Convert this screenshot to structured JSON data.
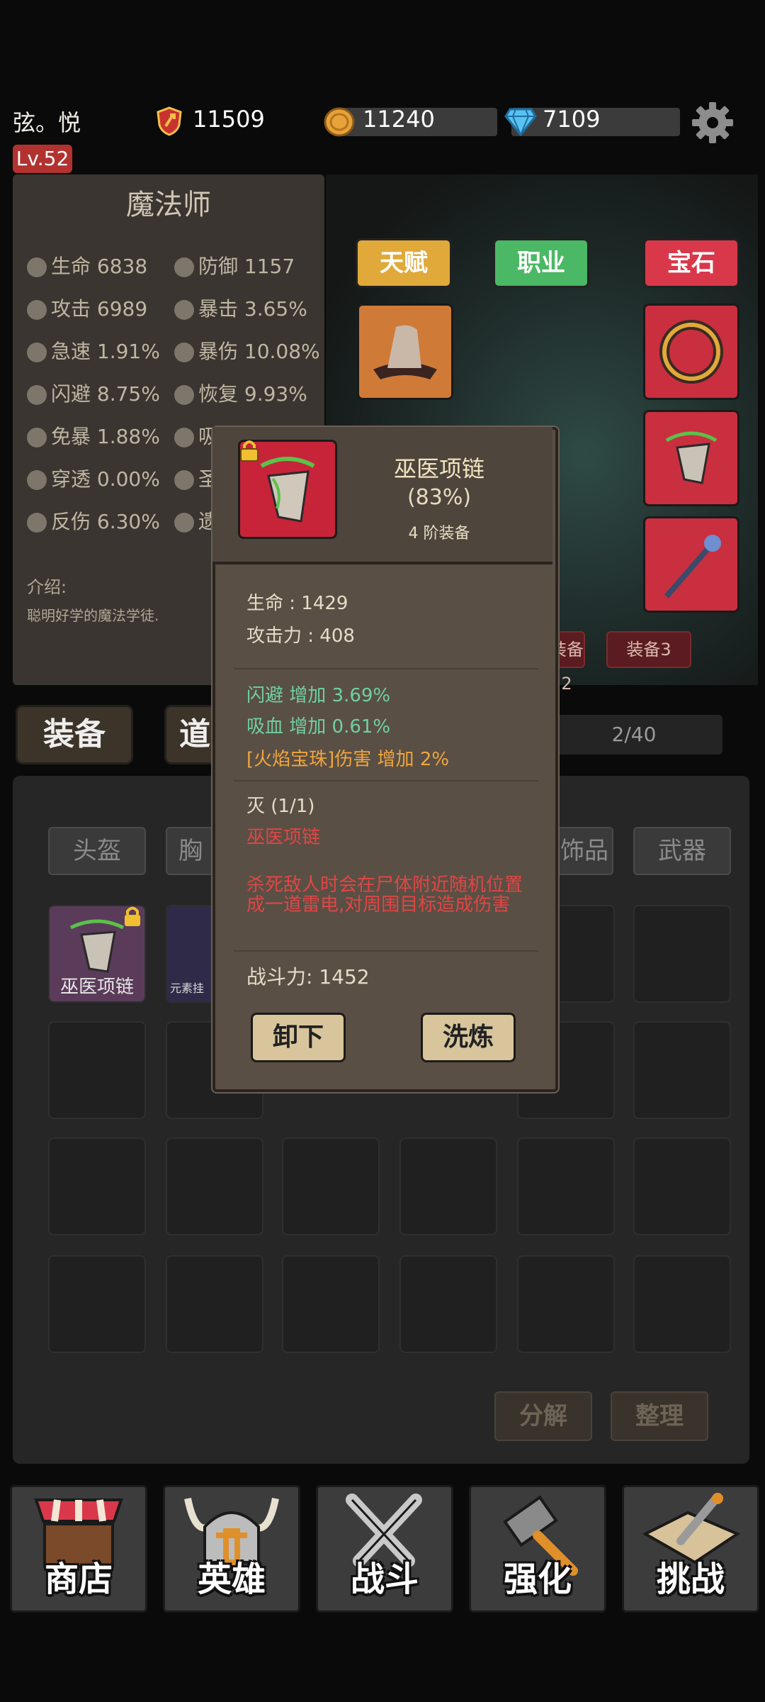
{
  "top_bar": {
    "player_name": "弦。悦",
    "level": "Lv.52",
    "power": "11509",
    "coins": "11240",
    "gems": "7109"
  },
  "hero_panel": {
    "class_name": "魔法师",
    "stats": [
      {
        "label": "生命 6838"
      },
      {
        "label": "防御 1157"
      },
      {
        "label": "攻击 6989"
      },
      {
        "label": "暴击 3.65%"
      },
      {
        "label": "急速 1.91%"
      },
      {
        "label": "暴伤 10.08%"
      },
      {
        "label": "闪避 8.75%"
      },
      {
        "label": "恢复 9.93%"
      },
      {
        "label": "免暴 1.88%"
      },
      {
        "label": "吸"
      },
      {
        "label": "穿透 0.00%"
      },
      {
        "label": "圣"
      },
      {
        "label": "反伤 6.30%"
      },
      {
        "label": "遗"
      }
    ],
    "intro_label": "介绍:",
    "intro_text": "聪明好学的魔法学徒."
  },
  "hero_tabs": {
    "talent": "天赋",
    "job": "职业",
    "gem": "宝石"
  },
  "equip_tags": {
    "tag2": "装备2",
    "tag3": "装备3"
  },
  "lower_tabs": {
    "equipment": "装备",
    "items": "道",
    "bag_count": "2/40"
  },
  "filter_tabs": {
    "helmet": "头盔",
    "chest": "胸",
    "accessory": "饰品",
    "weapon": "武器"
  },
  "inventory": {
    "item1_name": "巫医项链",
    "item2_name": "元素挂",
    "decompose": "分解",
    "sort": "整理"
  },
  "nav": {
    "shop": "商店",
    "hero": "英雄",
    "battle": "战斗",
    "upgrade": "强化",
    "challenge": "挑战"
  },
  "popup": {
    "item_name": "巫医项链",
    "quality": "(83%)",
    "tier": "4 阶装备",
    "base_stats": [
      "生命 : 1429",
      "攻击力 : 408"
    ],
    "bonus_stats": [
      {
        "text": "闪避 增加 3.69%",
        "color": "#6fcfa5"
      },
      {
        "text": "吸血 增加 0.61%",
        "color": "#6fcfa5"
      },
      {
        "text": "[火焰宝珠]伤害 增加 2%",
        "color": "#f0a640"
      }
    ],
    "set_name": "灭 (1/1)",
    "set_item": "巫医项链",
    "set_effect": "杀死敌人时会在尸体附近随机位置成一道雷电,对周围目标造成伤害",
    "combat_power": "战斗力: 1452",
    "unequip": "卸下",
    "refine": "洗炼"
  },
  "colors": {
    "accent_red": "#c92f3f",
    "green_text": "#6fcfa5",
    "orange_text": "#f0a640",
    "red_text": "#e04646",
    "tab_talent": "#e0a93a",
    "tab_job": "#4bb865",
    "tab_gem": "#d9384a"
  },
  "icons": [
    "power-shield-icon",
    "coin-icon",
    "gem-icon",
    "gear-icon",
    "lock-icon",
    "necklace-icon",
    "hat-icon",
    "ring-icon",
    "staff-icon",
    "shop-icon",
    "helmet-icon",
    "swords-icon",
    "hammer-icon",
    "challenge-icon"
  ]
}
